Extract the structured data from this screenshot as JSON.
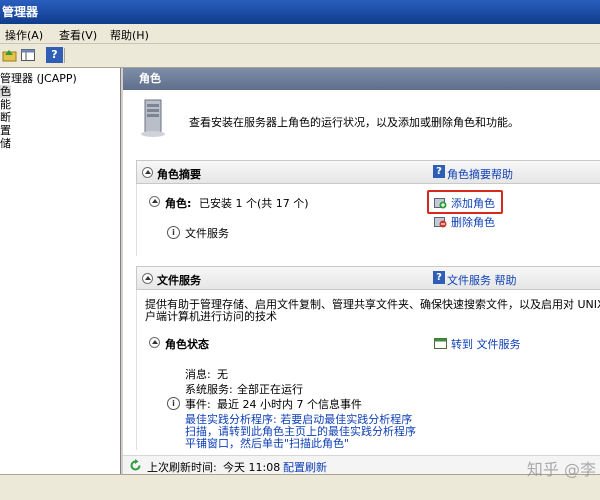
{
  "window": {
    "title": "管理器"
  },
  "menu": {
    "items": [
      "操作(A)",
      "查看(V)",
      "帮助(H)"
    ]
  },
  "toolbar": {
    "help_glyph": "?"
  },
  "tree": {
    "root": "管理器 (JCAPP)",
    "items": [
      "色",
      "能",
      "断",
      "置",
      "储"
    ]
  },
  "main": {
    "header": "角色",
    "intro": "查看安装在服务器上角色的运行状况，以及添加或删除角色和功能。",
    "summary": {
      "title": "角色摘要",
      "help": "角色摘要帮助",
      "roles_label": "角色:",
      "roles_value": "已安装 1 个(共 17 个)",
      "file_service": "文件服务",
      "add_roles": "添加角色",
      "remove_roles": "删除角色"
    },
    "file_services": {
      "title": "文件服务",
      "help": "文件服务 帮助",
      "desc_line1": "提供有助于管理存储、启用文件复制、管理共享文件夹、确保快速搜索文件，以及启用对 UNIX 客",
      "desc_line2": "户端计算机进行访问的技术",
      "status_title": "角色状态",
      "goto": "转到 文件服务",
      "messages_label": "消息:",
      "messages_value": "无",
      "system_services_label": "系统服务:",
      "system_services_value": "全部正在运行",
      "events_label": "事件:",
      "events_value": "最近 24 小时内 7 个信息事件",
      "bpa_line1": "最佳实践分析程序: 若要启动最佳实践分析程序",
      "bpa_line2": "扫描，请转到此角色主页上的最佳实践分析程序",
      "bpa_line3": "平铺窗口，然后单击\"扫描此角色\""
    }
  },
  "status": {
    "last_refresh_label": "上次刷新时间:",
    "last_refresh_value": "今天 11:08",
    "configure_refresh": "配置刷新"
  },
  "watermark": "知乎 @李"
}
